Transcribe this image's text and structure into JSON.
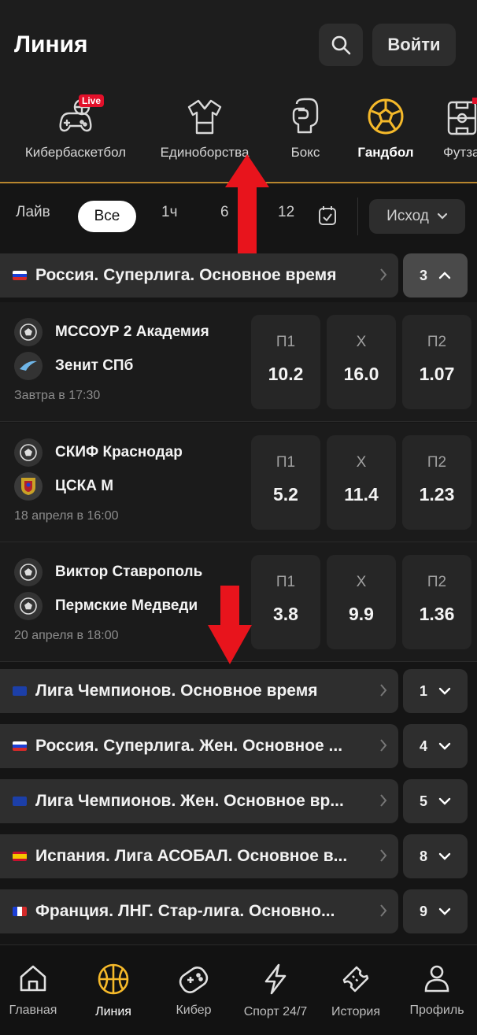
{
  "header": {
    "title": "Линия",
    "login_label": "Войти"
  },
  "sports": [
    {
      "label": "Кибербаскетбол",
      "icon": "cyber-basketball-icon",
      "badge": "Live"
    },
    {
      "label": "Единоборства",
      "icon": "martial-arts-icon"
    },
    {
      "label": "Бокс",
      "icon": "boxing-glove-icon"
    },
    {
      "label": "Гандбол",
      "icon": "handball-icon",
      "active": true
    },
    {
      "label": "Футза",
      "icon": "futsal-icon"
    }
  ],
  "filters": {
    "live": "Лайв",
    "all": "Все",
    "h1": "1ч",
    "h6": "6",
    "h12": "12",
    "outcome": "Исход"
  },
  "leagues": [
    {
      "name": "Россия. Суперлига. Основное время",
      "count": "3",
      "flag": "ru",
      "open": true
    },
    {
      "name": "Лига Чемпионов. Основное время",
      "count": "1",
      "flag": "eu"
    },
    {
      "name": "Россия. Суперлига. Жен. Основное ...",
      "count": "4",
      "flag": "ru"
    },
    {
      "name": "Лига Чемпионов. Жен. Основное вр...",
      "count": "5",
      "flag": "eu"
    },
    {
      "name": "Испания. Лига АСОБАЛ. Основное в...",
      "count": "8",
      "flag": "es"
    },
    {
      "name": "Франция. ЛНГ. Стар-лига. Основно...",
      "count": "9",
      "flag": "fr"
    }
  ],
  "matches": [
    {
      "team1": "МССОУР 2 Академия",
      "team2": "Зенит СПб",
      "time": "Завтра в 17:30",
      "odds": [
        {
          "label": "П1",
          "value": "10.2"
        },
        {
          "label": "Х",
          "value": "16.0"
        },
        {
          "label": "П2",
          "value": "1.07"
        }
      ]
    },
    {
      "team1": "СКИФ Краснодар",
      "team2": "ЦСКА М",
      "time": "18 апреля в 16:00",
      "odds": [
        {
          "label": "П1",
          "value": "5.2"
        },
        {
          "label": "Х",
          "value": "11.4"
        },
        {
          "label": "П2",
          "value": "1.23"
        }
      ]
    },
    {
      "team1": "Виктор Ставрополь",
      "team2": "Пермские Медведи",
      "time": "20 апреля в 18:00",
      "odds": [
        {
          "label": "П1",
          "value": "3.8"
        },
        {
          "label": "Х",
          "value": "9.9"
        },
        {
          "label": "П2",
          "value": "1.36"
        }
      ]
    }
  ],
  "nav": [
    {
      "label": "Главная",
      "icon": "home-icon"
    },
    {
      "label": "Линия",
      "icon": "basketball-icon",
      "active": true
    },
    {
      "label": "Кибер",
      "icon": "gamepad-icon"
    },
    {
      "label": "Спорт 24/7",
      "icon": "lightning-icon"
    },
    {
      "label": "История",
      "icon": "ticket-icon"
    },
    {
      "label": "Профиль",
      "icon": "profile-icon"
    }
  ],
  "colors": {
    "accent": "#f5b92a",
    "live": "#e3102a",
    "arrow": "#e8141c"
  }
}
